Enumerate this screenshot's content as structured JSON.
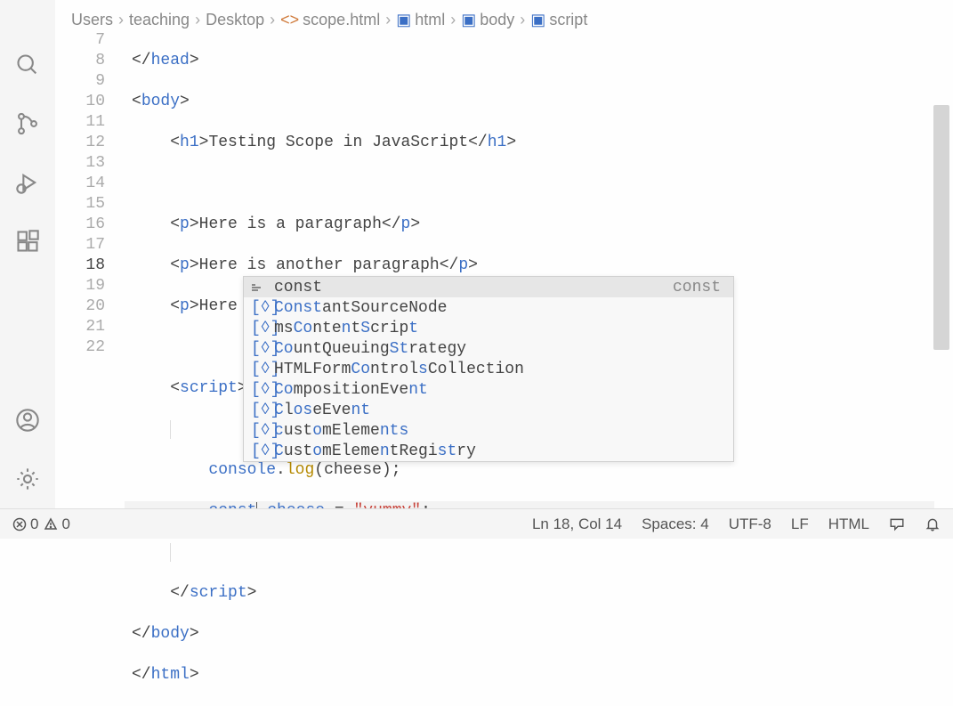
{
  "breadcrumb": [
    {
      "label": "Users",
      "icon": null
    },
    {
      "label": "teaching",
      "icon": null
    },
    {
      "label": "Desktop",
      "icon": null
    },
    {
      "label": "scope.html",
      "icon": "code"
    },
    {
      "label": "html",
      "icon": "cube"
    },
    {
      "label": "body",
      "icon": "cube"
    },
    {
      "label": "script",
      "icon": "cube"
    }
  ],
  "lines": {
    "start": 7,
    "current": 18,
    "count": 16,
    "l7": "</head>",
    "l8": {
      "open": "<body>",
      "tag": "body"
    },
    "l9": {
      "h1": "h1",
      "text": "Testing Scope in JavaScript"
    },
    "l11": {
      "p": "p",
      "text": "Here is a paragraph"
    },
    "l12": {
      "p": "p",
      "text": "Here is another paragraph"
    },
    "l13": {
      "p": "p",
      "text": "Here is one more paragraph"
    },
    "l15": {
      "tag": "script"
    },
    "l17": {
      "obj": "console",
      "fn": "log",
      "arg": "cheese"
    },
    "l18": {
      "kw": "const",
      "name": "cheese",
      "op": "=",
      "str": "\"yummy\"",
      "sc": ";"
    },
    "l20": {
      "close": "script"
    },
    "l21": {
      "close": "body"
    },
    "l22": {
      "close": "html"
    }
  },
  "suggest": {
    "hint": "const",
    "items": [
      {
        "label": "const",
        "icon": "kw",
        "sel": true
      },
      {
        "label": "ConstantSourceNode",
        "icon": "var"
      },
      {
        "label": "msContentScript",
        "icon": "var"
      },
      {
        "label": "CountQueuingStrategy",
        "icon": "var"
      },
      {
        "label": "HTMLFormControlsCollection",
        "icon": "var"
      },
      {
        "label": "CompositionEvent",
        "icon": "var"
      },
      {
        "label": "CloseEvent",
        "icon": "var"
      },
      {
        "label": "customElements",
        "icon": "var"
      },
      {
        "label": "CustomElementRegistry",
        "icon": "var"
      }
    ]
  },
  "status": {
    "errors": "0",
    "warnings": "0",
    "pos": "Ln 18, Col 14",
    "spaces": "Spaces: 4",
    "encoding": "UTF-8",
    "eol": "LF",
    "lang": "HTML"
  }
}
